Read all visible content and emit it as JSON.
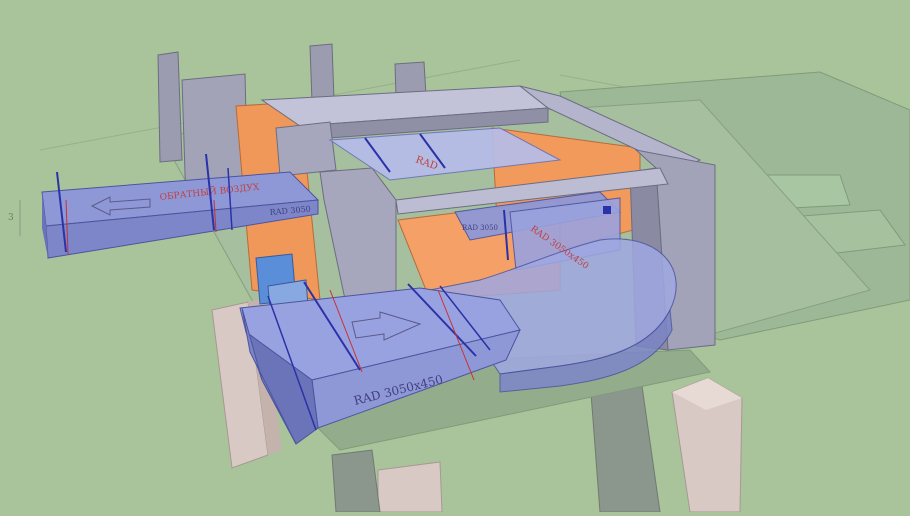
{
  "scene": {
    "duct_labels": {
      "supply_main": "RAD 3050x450",
      "exhaust_outlet": "RAD 3050",
      "exhaust_arrow_text": "ОБРАТНЫЙ ВОЗДУХ",
      "curved_section": "RAD 3050x450",
      "inner_unit": "RAD 3050",
      "top_duct": "RAD"
    },
    "dimension_mark": "3",
    "colors": {
      "sky": "#a9c49a",
      "ground_slab": "#9fb898",
      "duct_blue": "#8f98d6",
      "duct_blue_dark": "#6b74b8",
      "concrete": "#9a9aae",
      "concrete_dark": "#7c7c92",
      "orange_wall": "#f0975a",
      "pillar_pink": "#d8c6c2",
      "flange_blue": "#2a32a8",
      "hanger_red": "#c83030"
    }
  }
}
